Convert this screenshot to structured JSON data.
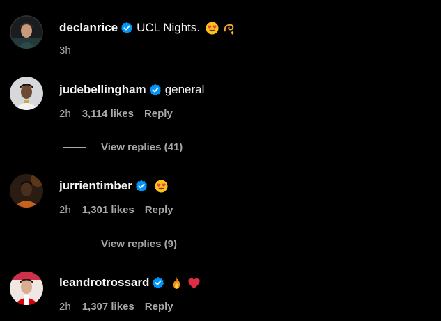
{
  "caption": {
    "username": "declanrice",
    "text": "UCL Nights.",
    "emojis": [
      "heart-eyes-emoji",
      "dizzy-emoji"
    ],
    "time": "3h"
  },
  "comments": [
    {
      "username": "judebellingham",
      "text": "general",
      "emojis": [],
      "time": "2h",
      "likes": "3,114 likes",
      "reply_label": "Reply",
      "view_replies": "View replies (41)"
    },
    {
      "username": "jurrientimber",
      "text": "",
      "emojis": [
        "heart-eyes-emoji"
      ],
      "time": "2h",
      "likes": "1,301 likes",
      "reply_label": "Reply",
      "view_replies": "View replies (9)"
    },
    {
      "username": "leandrotrossard",
      "text": "",
      "emojis": [
        "fire-emoji",
        "red-heart-emoji"
      ],
      "time": "2h",
      "likes": "1,307 likes",
      "reply_label": "Reply"
    }
  ],
  "colors": {
    "background": "#000000",
    "primary_text": "#f5f5f5",
    "secondary_text": "#a8a8a8",
    "verified_badge": "#0095f6"
  }
}
